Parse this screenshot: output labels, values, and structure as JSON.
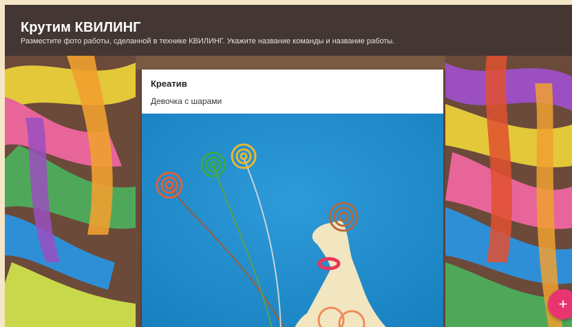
{
  "header": {
    "title": "Крутим КВИЛИНГ",
    "description": "Разместите фото работы, сделанной в технике КВИЛИНГ. Укажите название команды и название работы."
  },
  "post": {
    "author": "Креатив",
    "caption": "Девочка с шарами"
  },
  "fab": {
    "label": "+"
  },
  "colors": {
    "header_bg": "#433633",
    "fab": "#e8356f",
    "photo_bg": "#1e8fd0"
  }
}
